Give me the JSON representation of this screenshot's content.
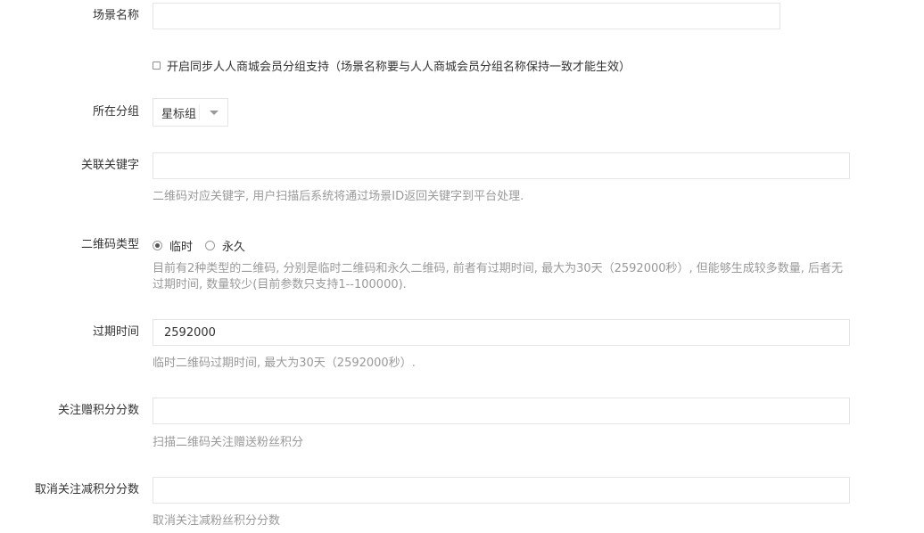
{
  "form": {
    "scene_name": {
      "label": "场景名称",
      "value": "",
      "sync_checkbox_label": "开启同步人人商城会员分组支持（场景名称要与人人商城会员分组名称保持一致才能生效）",
      "sync_checked": false
    },
    "group": {
      "label": "所在分组",
      "selected": "星标组"
    },
    "keyword": {
      "label": "关联关键字",
      "value": "",
      "help": "二维码对应关键字, 用户扫描后系统将通过场景ID返回关键字到平台处理."
    },
    "qr_type": {
      "label": "二维码类型",
      "options": [
        {
          "label": "临时",
          "checked": true
        },
        {
          "label": "永久",
          "checked": false
        }
      ],
      "help": "目前有2种类型的二维码, 分别是临时二维码和永久二维码, 前者有过期时间, 最大为30天（2592000秒）, 但能够生成较多数量, 后者无过期时间, 数量较少(目前参数只支持1--100000)."
    },
    "expire": {
      "label": "过期时间",
      "value": "2592000",
      "help": "临时二维码过期时间, 最大为30天（2592000秒）."
    },
    "follow_points": {
      "label": "关注赠积分分数",
      "value": "",
      "help": "扫描二维码关注赠送粉丝积分"
    },
    "unfollow_points": {
      "label": "取消关注减积分分数",
      "value": "",
      "help": "取消关注减粉丝积分分数"
    }
  }
}
